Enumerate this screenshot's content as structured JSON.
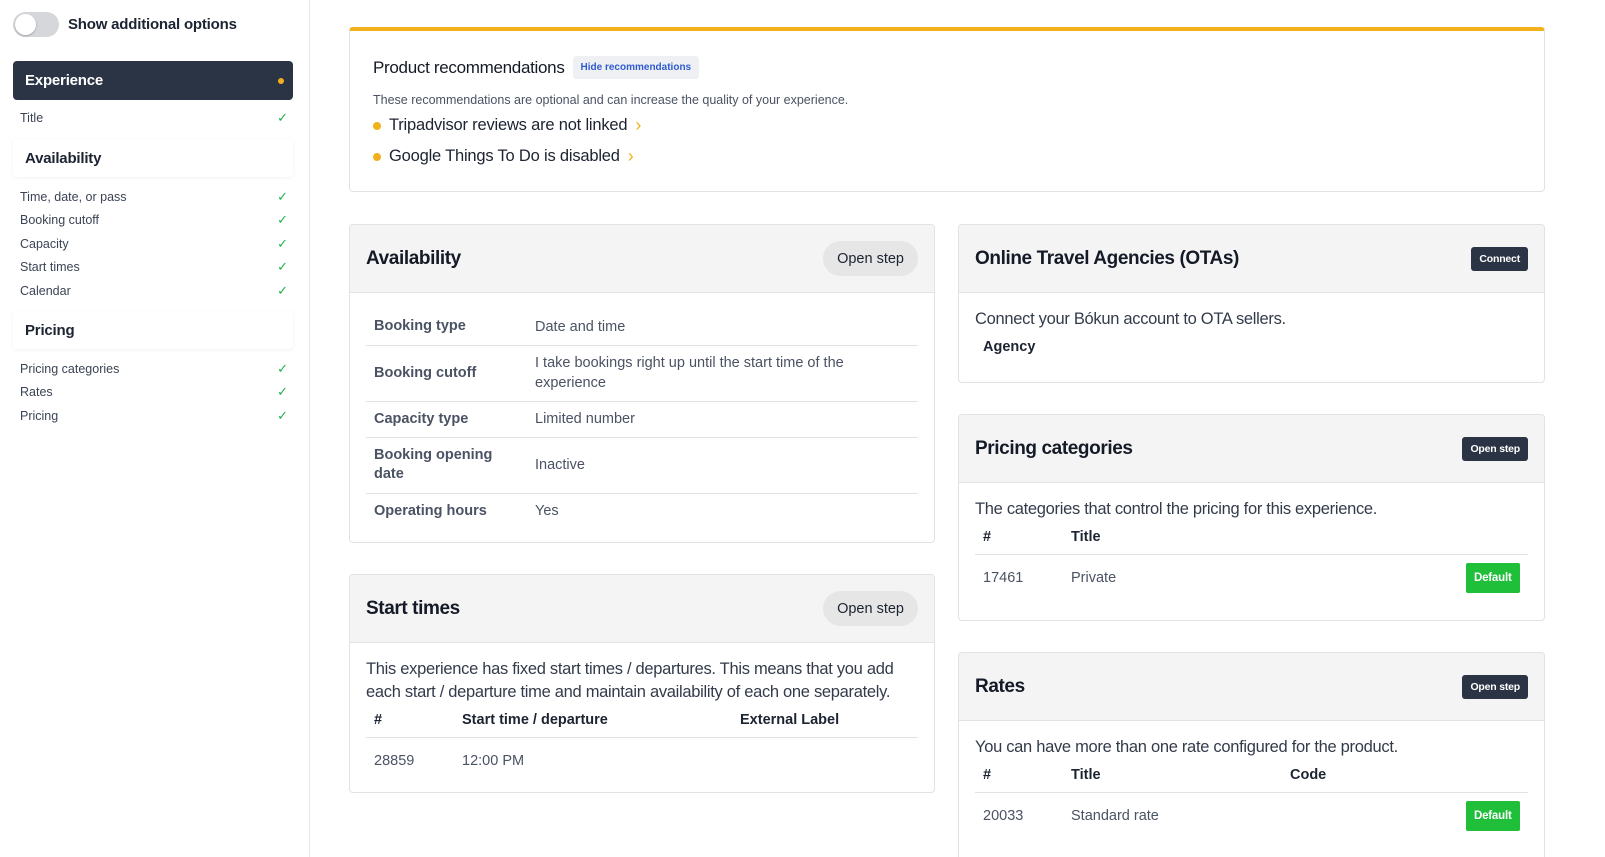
{
  "sidebar": {
    "toggle_label": "Show additional options",
    "sections": [
      {
        "label": "Experience",
        "items": [
          {
            "label": "Title"
          }
        ]
      },
      {
        "label": "Availability",
        "items": [
          {
            "label": "Time, date, or pass"
          },
          {
            "label": "Booking cutoff"
          },
          {
            "label": "Capacity"
          },
          {
            "label": "Start times"
          },
          {
            "label": "Calendar"
          }
        ]
      },
      {
        "label": "Pricing",
        "items": [
          {
            "label": "Pricing categories"
          },
          {
            "label": "Rates"
          },
          {
            "label": "Pricing"
          }
        ]
      }
    ]
  },
  "recommendations": {
    "title": "Product recommendations",
    "hide_label": "Hide recommendations",
    "subtitle": "These recommendations are optional and can increase the quality of your experience.",
    "items": [
      {
        "label": "Tripadvisor reviews are not linked"
      },
      {
        "label": "Google Things To Do is disabled"
      }
    ]
  },
  "availability": {
    "title": "Availability",
    "button": "Open step",
    "rows": [
      {
        "key": "Booking type",
        "value": "Date and time"
      },
      {
        "key": "Booking cutoff",
        "value": "I take bookings right up until the start time of the experience"
      },
      {
        "key": "Capacity type",
        "value": "Limited number"
      },
      {
        "key": "Booking opening date",
        "value": "Inactive"
      },
      {
        "key": "Operating hours",
        "value": "Yes"
      }
    ]
  },
  "start_times": {
    "title": "Start times",
    "button": "Open step",
    "description": "This experience has fixed start times / departures. This means that you add each start / departure time and maintain availability of each one separately.",
    "columns": [
      "#",
      "Start time / departure",
      "External Label"
    ],
    "rows": [
      {
        "id": "28859",
        "time": "12:00 PM",
        "label": ""
      }
    ]
  },
  "otas": {
    "title": "Online Travel Agencies (OTAs)",
    "button": "Connect",
    "description": "Connect your Bókun account to OTA sellers.",
    "agency_label": "Agency"
  },
  "pricing_categories": {
    "title": "Pricing categories",
    "button": "Open step",
    "description": "The categories that control the pricing for this experience.",
    "columns": [
      "#",
      "Title"
    ],
    "rows": [
      {
        "id": "17461",
        "title": "Private",
        "badge": "Default"
      }
    ]
  },
  "rates": {
    "title": "Rates",
    "button": "Open step",
    "description": "You can have more than one rate configured for the product.",
    "columns": [
      "#",
      "Title",
      "Code"
    ],
    "rows": [
      {
        "id": "20033",
        "title": "Standard rate",
        "code": "",
        "badge": "Default"
      }
    ]
  },
  "colors": {
    "accent_amber": "#f2b11c",
    "dark_navy": "#2b3445",
    "success_green": "#1fbf3a",
    "link_blue": "#2f5bd0"
  },
  "icons": {
    "check": "check-icon",
    "chevron": "chevron-right-icon",
    "status_dot": "status-dot-icon"
  }
}
